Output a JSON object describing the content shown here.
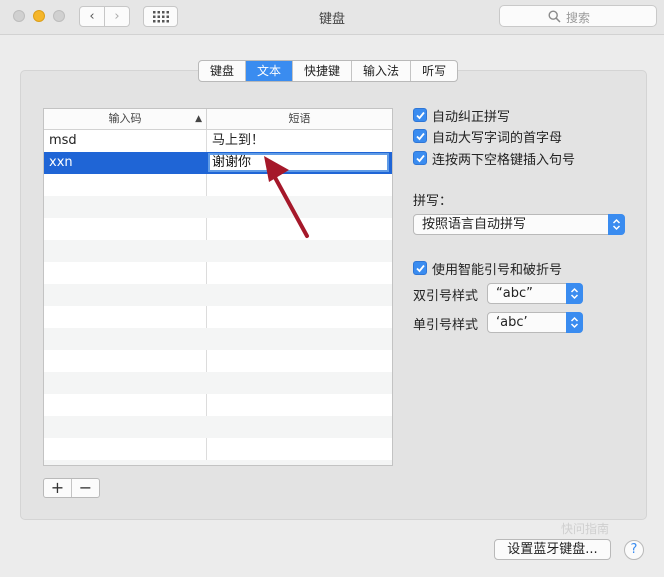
{
  "window": {
    "title": "键盘"
  },
  "search": {
    "placeholder": "搜索"
  },
  "tabs": [
    {
      "label": "键盘",
      "active": false
    },
    {
      "label": "文本",
      "active": true
    },
    {
      "label": "快捷键",
      "active": false
    },
    {
      "label": "输入法",
      "active": false
    },
    {
      "label": "听写",
      "active": false
    }
  ],
  "table": {
    "columns": [
      "输入码",
      "短语"
    ],
    "rows": [
      {
        "code": "msd",
        "phrase": "马上到！"
      },
      {
        "code": "xxn",
        "phrase": "谢谢你",
        "selected": true
      }
    ]
  },
  "options": {
    "autocorrect": {
      "label": "自动纠正拼写",
      "checked": true
    },
    "autocapitalize": {
      "label": "自动大写字词的首字母",
      "checked": true
    },
    "double_space": {
      "label": "连按两下空格键插入句号",
      "checked": true
    }
  },
  "spelling": {
    "label": "拼写：",
    "value": "按照语言自动拼写"
  },
  "smart_quotes": {
    "label": "使用智能引号和破折号",
    "checked": true
  },
  "double_quote": {
    "label": "双引号样式",
    "value": "“abc”"
  },
  "single_quote": {
    "label": "单引号样式",
    "value": "‘abc’"
  },
  "footer": {
    "bluetooth_label": "设置蓝牙键盘...",
    "help_label": "?"
  },
  "table_buttons": {
    "add": "+",
    "remove": "−"
  },
  "watermark": "快问指南",
  "colors": {
    "accent": "#3a8cf0",
    "selection": "#1f65d6",
    "annotation": "#a5182a"
  }
}
